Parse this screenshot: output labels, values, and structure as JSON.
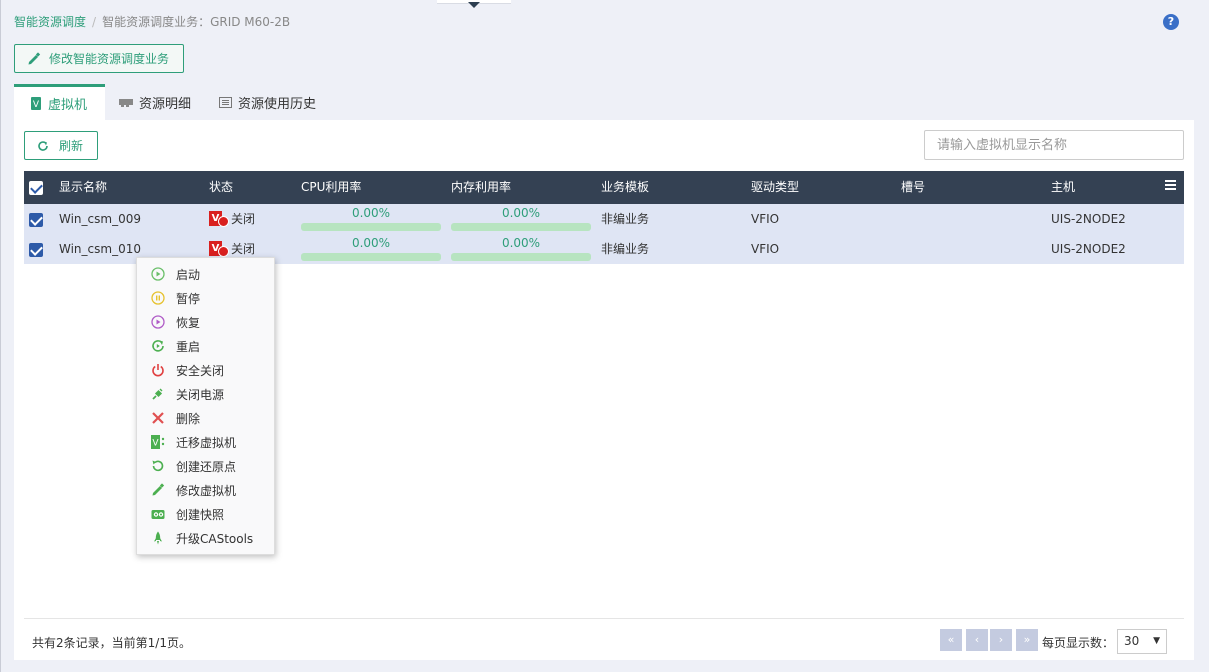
{
  "breadcrumb": {
    "root": "智能资源调度",
    "separator": "/",
    "current": "智能资源调度业务：GRID M60-2B"
  },
  "help_icon": "?",
  "toolbar": {
    "modify_service": "修改智能资源调度业务"
  },
  "tabs": [
    {
      "label": "虚拟机",
      "active": true,
      "icon": "vm-icon"
    },
    {
      "label": "资源明细",
      "active": false,
      "icon": "gpu-card-icon"
    },
    {
      "label": "资源使用历史",
      "active": false,
      "icon": "history-list-icon"
    }
  ],
  "refresh_label": "刷新",
  "search": {
    "placeholder": "请输入虚拟机显示名称",
    "value": ""
  },
  "table": {
    "columns": [
      "显示名称",
      "状态",
      "CPU利用率",
      "内存利用率",
      "业务模板",
      "驱动类型",
      "槽号",
      "主机"
    ],
    "rows": [
      {
        "name": "Win_csm_009",
        "status": "关闭",
        "cpu": "0.00%",
        "cpu_value": 0,
        "mem": "0.00%",
        "mem_value": 0,
        "template": "非编业务",
        "driver": "VFIO",
        "slot": "",
        "host": "UIS-2NODE2",
        "checked": true
      },
      {
        "name": "Win_csm_010",
        "status": "关闭",
        "cpu": "0.00%",
        "cpu_value": 0,
        "mem": "0.00%",
        "mem_value": 0,
        "template": "非编业务",
        "driver": "VFIO",
        "slot": "",
        "host": "UIS-2NODE2",
        "checked": true
      }
    ]
  },
  "context_menu": [
    {
      "label": "启动",
      "icon": "play-icon",
      "color": "#6abf69"
    },
    {
      "label": "暂停",
      "icon": "pause-icon",
      "color": "#e6c22e"
    },
    {
      "label": "恢复",
      "icon": "resume-icon",
      "color": "#b05cc7"
    },
    {
      "label": "重启",
      "icon": "restart-icon",
      "color": "#4caf50"
    },
    {
      "label": "安全关闭",
      "icon": "power-icon",
      "color": "#e04040"
    },
    {
      "label": "关闭电源",
      "icon": "plug-icon",
      "color": "#4caf50"
    },
    {
      "label": "删除",
      "icon": "delete-x-icon",
      "color": "#e05050"
    },
    {
      "label": "迁移虚拟机",
      "icon": "migrate-vm-icon",
      "color": "#4caf50"
    },
    {
      "label": "创建还原点",
      "icon": "restore-point-icon",
      "color": "#4caf50"
    },
    {
      "label": "修改虚拟机",
      "icon": "edit-pencil-icon",
      "color": "#4caf50"
    },
    {
      "label": "创建快照",
      "icon": "snapshot-icon",
      "color": "#4caf50"
    },
    {
      "label": "升级CAStools",
      "icon": "rocket-icon",
      "color": "#4caf50"
    }
  ],
  "footer": {
    "record_info": "共有2条记录，当前第1/1页。",
    "pager": [
      "«",
      "‹",
      "›",
      "»"
    ],
    "per_page_label": "每页显示数：",
    "per_page_value": "30"
  },
  "colors": {
    "accent": "#2e9e7a",
    "header_bg": "#344153",
    "row_bg": "#dfe5f4",
    "danger": "#d9201f"
  }
}
